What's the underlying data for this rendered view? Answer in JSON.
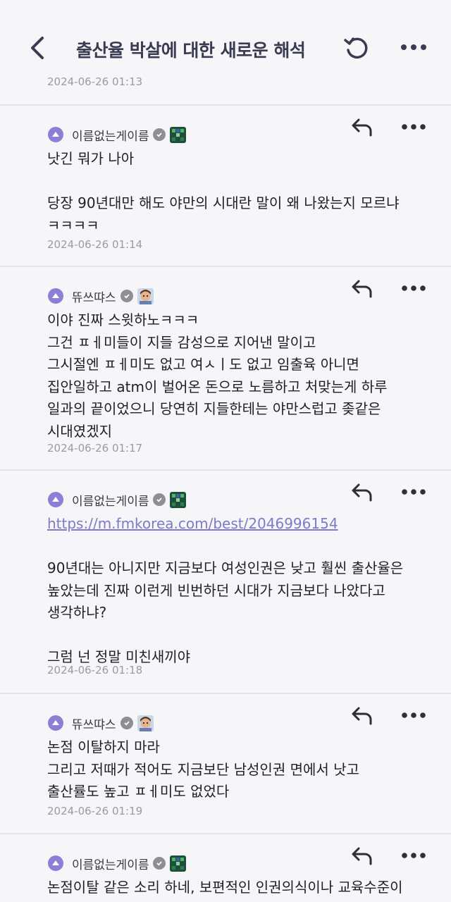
{
  "header": {
    "title": "출산율 박살에 대한 새로운 해석",
    "top_date": "2024-06-26 01:13"
  },
  "comments": [
    {
      "author": "이름없는게이름",
      "avatar": "green-pixel-avatar",
      "lines": [
        "낫긴 뭐가 나아",
        "",
        "당장 90년대만 해도 야만의 시대란 말이 왜 나왔는지 모르냐",
        "ㅋㅋㅋㅋ"
      ],
      "date": "2024-06-26 01:14"
    },
    {
      "author": "뜌쓰땨스",
      "avatar": "face-avatar",
      "lines": [
        "이야 진짜 스윗하노ㅋㅋㅋ",
        "그건 ㅍㅔ미들이 지들 감성으로 지어낸 말이고",
        "그시절엔 ㅍㅔ미도 없고 여ㅅㅣ도 없고 임출육 아니면",
        "집안일하고 atm이 벌어온 돈으로 노름하고 처맞는게 하루",
        "일과의 끝이었으니 당연히 지들한테는 야만스럽고 좆같은",
        "시대였겠지"
      ],
      "date": "2024-06-26 01:17"
    },
    {
      "author": "이름없는게이름",
      "avatar": "green-pixel-avatar",
      "link": "https://m.fmkorea.com/best/2046996154",
      "lines": [
        "",
        "90년대는 아니지만 지금보다 여성인권은 낮고 훨씬 출산율은",
        "높았는데 진짜 이런게 빈번하던 시대가 지금보다 나았다고",
        "생각하냐?",
        "",
        "그럼 넌 정말 미친새끼야"
      ],
      "date": "2024-06-26 01:18"
    },
    {
      "author": "뜌쓰땨스",
      "avatar": "face-avatar",
      "lines": [
        "논점 이탈하지 마라",
        "그리고 저때가 적어도 지금보단 남성인권 면에서 낫고",
        "출산률도 높고 ㅍㅔ미도 없었다"
      ],
      "date": "2024-06-26 01:19"
    },
    {
      "author": "이름없는게이름",
      "avatar": "green-pixel-avatar",
      "lines": [
        "논점이탈 같은 소리 하네, 보편적인 인권의식이나 교육수준이"
      ],
      "date": ""
    }
  ]
}
